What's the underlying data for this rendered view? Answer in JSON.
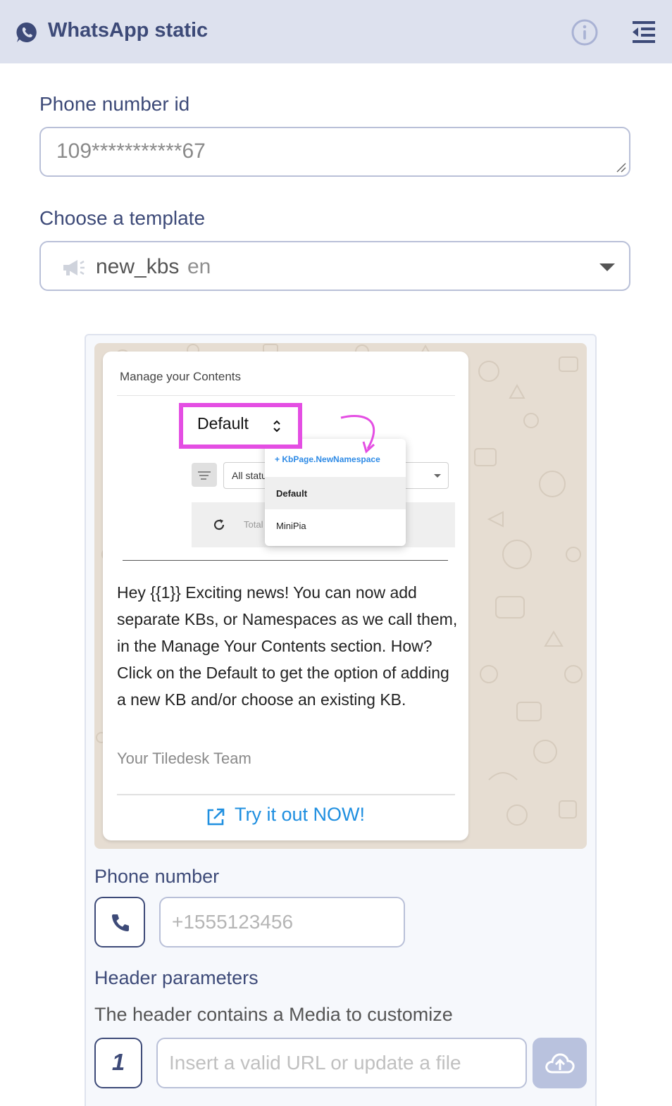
{
  "header": {
    "title": "WhatsApp static",
    "icons": [
      "whatsapp-icon",
      "info-icon",
      "collapse-menu-icon"
    ]
  },
  "phone_number_id": {
    "label": "Phone number id",
    "value": "109***********67"
  },
  "template": {
    "label": "Choose a template",
    "name": "new_kbs",
    "lang": "en"
  },
  "preview": {
    "media": {
      "title": "Manage your Contents",
      "default_label": "Default",
      "all_status": "All statu",
      "total": "Total",
      "menu": {
        "new_namespace": "+ KbPage.NewNamespace",
        "items": [
          "Default",
          "MiniPia"
        ]
      }
    },
    "body": "Hey {{1}} Exciting news! You can now add separate KBs, or Namespaces as we call them, in the Manage Your Contents section. How? Click on the Default to get the option of adding a new KB and/or choose an existing KB.",
    "footer": "Your Tiledesk Team",
    "button_label": "Try it out NOW!"
  },
  "phone_number": {
    "label": "Phone number",
    "placeholder": "+1555123456"
  },
  "header_parameters": {
    "label": "Header parameters",
    "description": "The header contains a Media to customize",
    "param_index": "1",
    "url_placeholder": "Insert a valid URL or update a file"
  },
  "colors": {
    "header_bg": "#dde1ee",
    "primary_text": "#3d4a78",
    "link_blue": "#1f8fe0",
    "highlight_pink": "#e44ee3",
    "chat_bg": "#e6ddd2"
  }
}
